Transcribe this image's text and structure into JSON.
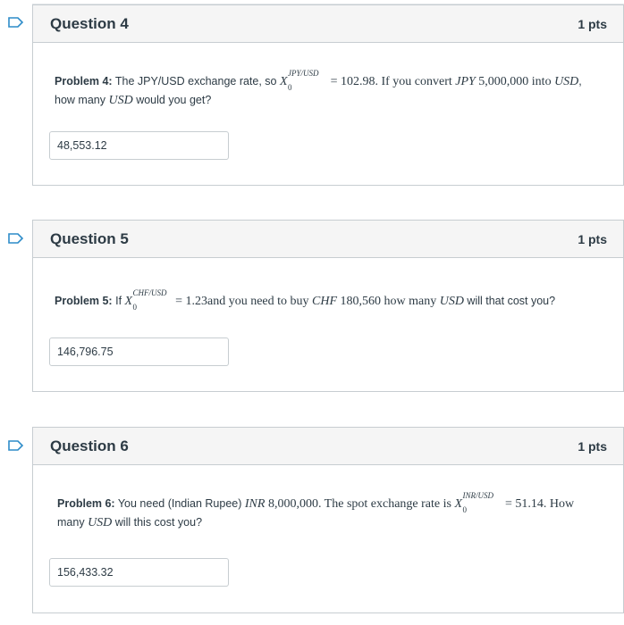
{
  "questions": [
    {
      "title": "Question 4",
      "points": "1 pts",
      "problem_label": "Problem 4:",
      "text_part1": "The JPY/USD exchange rate, so",
      "x_sup": "JPY/USD",
      "x_sub": "0",
      "text_part2": "= 102.98. If you convert",
      "currency1": "JPY",
      "amount1": "5,000,000 into",
      "currency2": "USD",
      "text_part3": ",",
      "line2_prefix": "how many",
      "line2_currency": "USD",
      "line2_suffix": "would you get?",
      "answer_value": "48,553.12"
    },
    {
      "title": "Question 5",
      "points": "1 pts",
      "problem_label": "Problem 5:",
      "text_part1": "If",
      "x_sup": "CHF/USD",
      "x_sub": "0",
      "text_part2": "= 1.23and you need to buy",
      "currency1": "CHF",
      "amount1": "180,560 how many",
      "currency2": "USD",
      "text_part3": "will that cost you?",
      "answer_value": "146,796.75"
    },
    {
      "title": "Question 6",
      "points": "1 pts",
      "problem_label": "Problem 6:",
      "text_part1": "You need (Indian Rupee)",
      "currency1": "INR",
      "amount1": "8,000,000. The spot exchange rate is",
      "x_sup": "INR/USD",
      "x_sub": "0",
      "text_part2": "= 51.14. How",
      "line2_prefix": "many",
      "line2_currency": "USD",
      "line2_suffix": "will this cost you?",
      "answer_value": "156,433.32"
    }
  ],
  "colors": {
    "flag_outline": "#2d8cc9",
    "header_bg": "#f5f5f5",
    "border": "#c7cdd1",
    "text": "#2d3b45"
  },
  "icons": {
    "flag": "bookmark-flag-icon"
  }
}
